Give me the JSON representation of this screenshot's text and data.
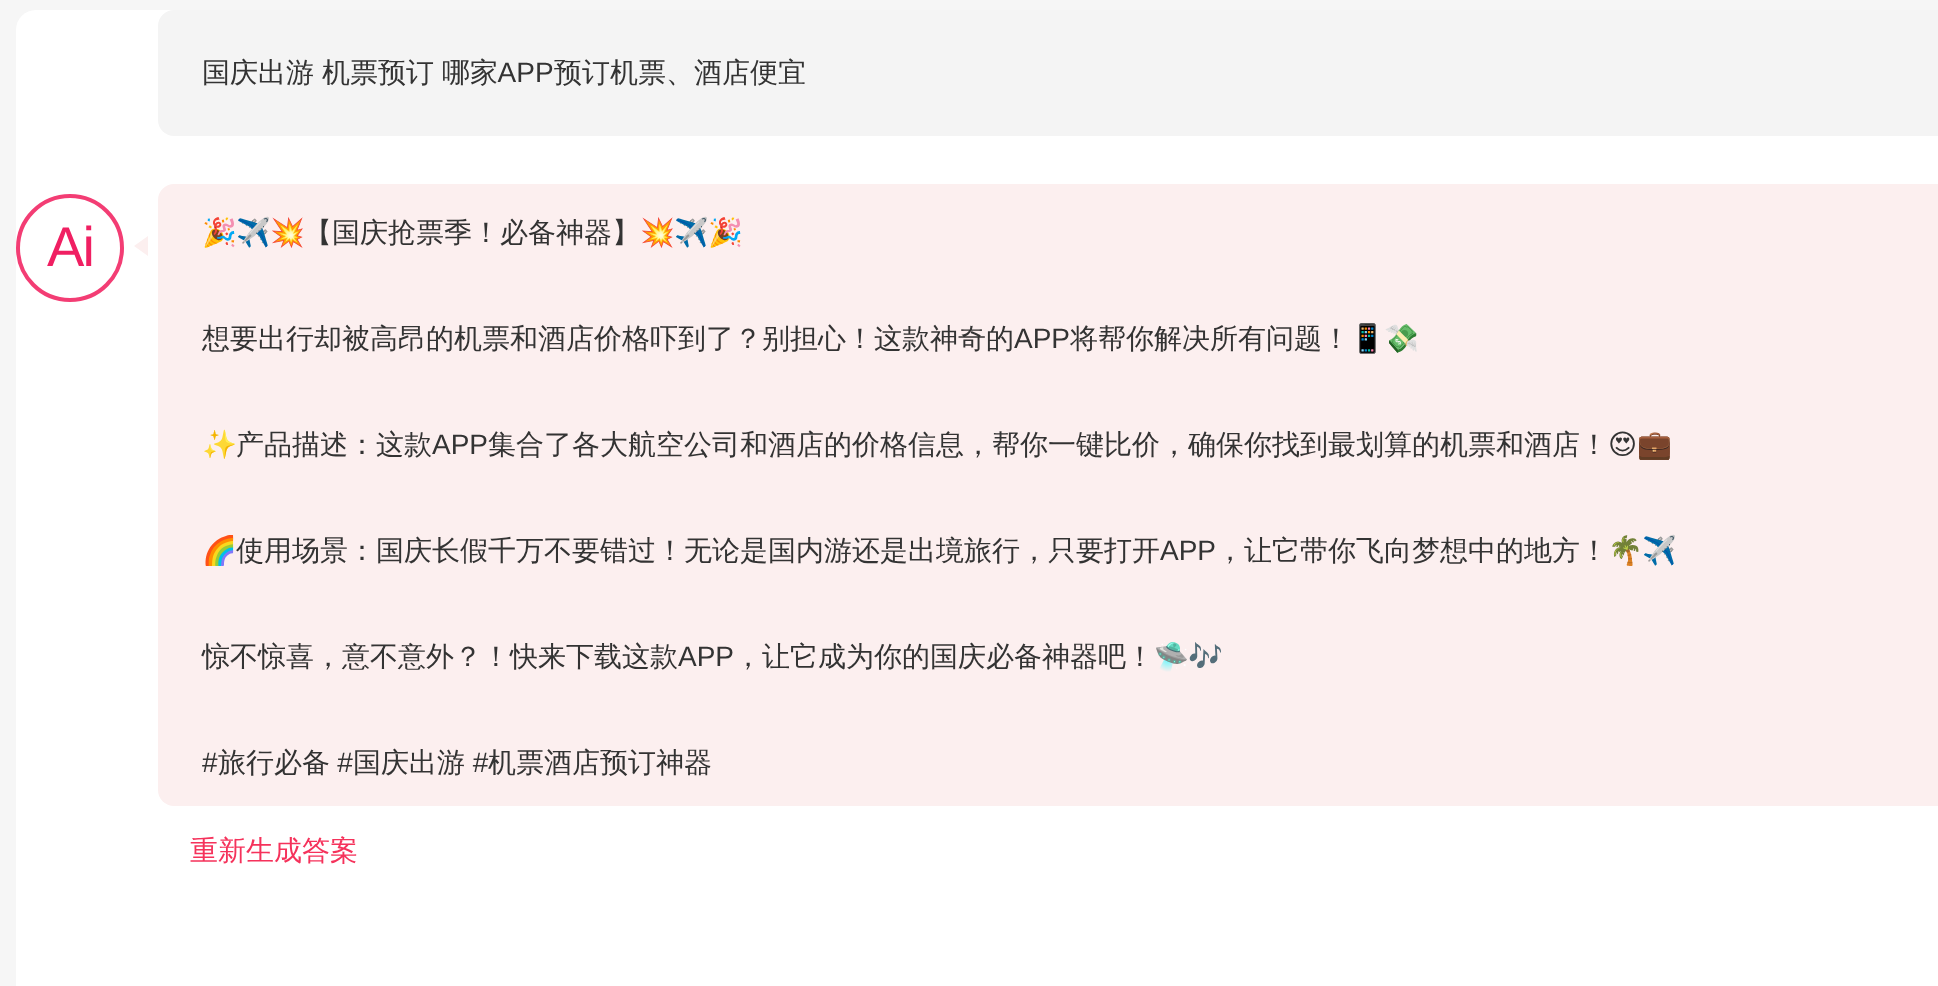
{
  "question": {
    "text": "国庆出游  机票预订  哪家APP预订机票、酒店便宜"
  },
  "answer": {
    "avatar": "Ai",
    "paragraphs": [
      "🎉✈️💥【国庆抢票季！必备神器】💥✈️🎉",
      "想要出行却被高昂的机票和酒店价格吓到了？别担心！这款神奇的APP将帮你解决所有问题！📱💸",
      "✨产品描述：这款APP集合了各大航空公司和酒店的价格信息，帮你一键比价，确保你找到最划算的机票和酒店！😍💼",
      "🌈使用场景：国庆长假千万不要错过！无论是国内游还是出境旅行，只要打开APP，让它带你飞向梦想中的地方！🌴✈️",
      "惊不惊喜，意不意外？！快来下载这款APP，让它成为你的国庆必备神器吧！🛸🎶",
      "#旅行必备 #国庆出游 #机票酒店预订神器"
    ]
  },
  "regenerate": "重新生成答案"
}
